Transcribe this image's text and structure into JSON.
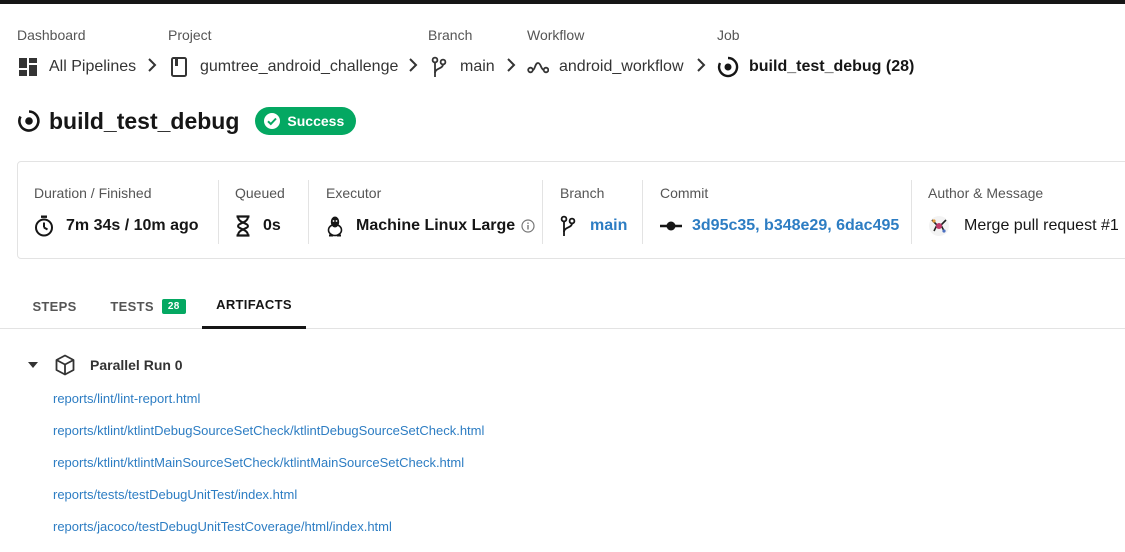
{
  "breadcrumbs": [
    {
      "label": "Dashboard",
      "value": "All Pipelines",
      "icon": "dashboard-grid-icon"
    },
    {
      "label": "Project",
      "value": "gumtree_android_challenge",
      "icon": "project-book-icon"
    },
    {
      "label": "Branch",
      "value": "main",
      "icon": "git-branch-icon"
    },
    {
      "label": "Workflow",
      "value": "android_workflow",
      "icon": "workflow-icon"
    },
    {
      "label": "Job",
      "value": "build_test_debug (28)",
      "icon": "job-icon"
    }
  ],
  "job": {
    "title": "build_test_debug",
    "status": "Success",
    "status_color": "#04a862"
  },
  "details": {
    "duration": {
      "label": "Duration / Finished",
      "value": "7m 34s / 10m ago",
      "icon": "stopwatch-icon"
    },
    "queued": {
      "label": "Queued",
      "value": "0s",
      "icon": "hourglass-icon"
    },
    "executor": {
      "label": "Executor",
      "value": "Machine Linux Large",
      "icon": "linux-penguin-icon"
    },
    "branch": {
      "label": "Branch",
      "value": "main",
      "icon": "git-branch-icon"
    },
    "commit": {
      "label": "Commit",
      "value": "3d95c35, b348e29, 6dac495",
      "icon": "commit-icon"
    },
    "author": {
      "label": "Author & Message",
      "value": "Merge pull request #1",
      "icon": "author-avatar"
    }
  },
  "tabs": [
    {
      "label": "STEPS",
      "active": false
    },
    {
      "label": "TESTS",
      "count": "28",
      "active": false
    },
    {
      "label": "ARTIFACTS",
      "active": true
    }
  ],
  "artifacts": {
    "group_label": "Parallel Run 0",
    "files": [
      "reports/lint/lint-report.html",
      "reports/ktlint/ktlintDebugSourceSetCheck/ktlintDebugSourceSetCheck.html",
      "reports/ktlint/ktlintMainSourceSetCheck/ktlintMainSourceSetCheck.html",
      "reports/tests/testDebugUnitTest/index.html",
      "reports/jacoco/testDebugUnitTestCoverage/html/index.html"
    ]
  },
  "colors": {
    "link": "#2d7dc3",
    "success": "#04a862",
    "text": "#161616",
    "muted": "#555555"
  }
}
